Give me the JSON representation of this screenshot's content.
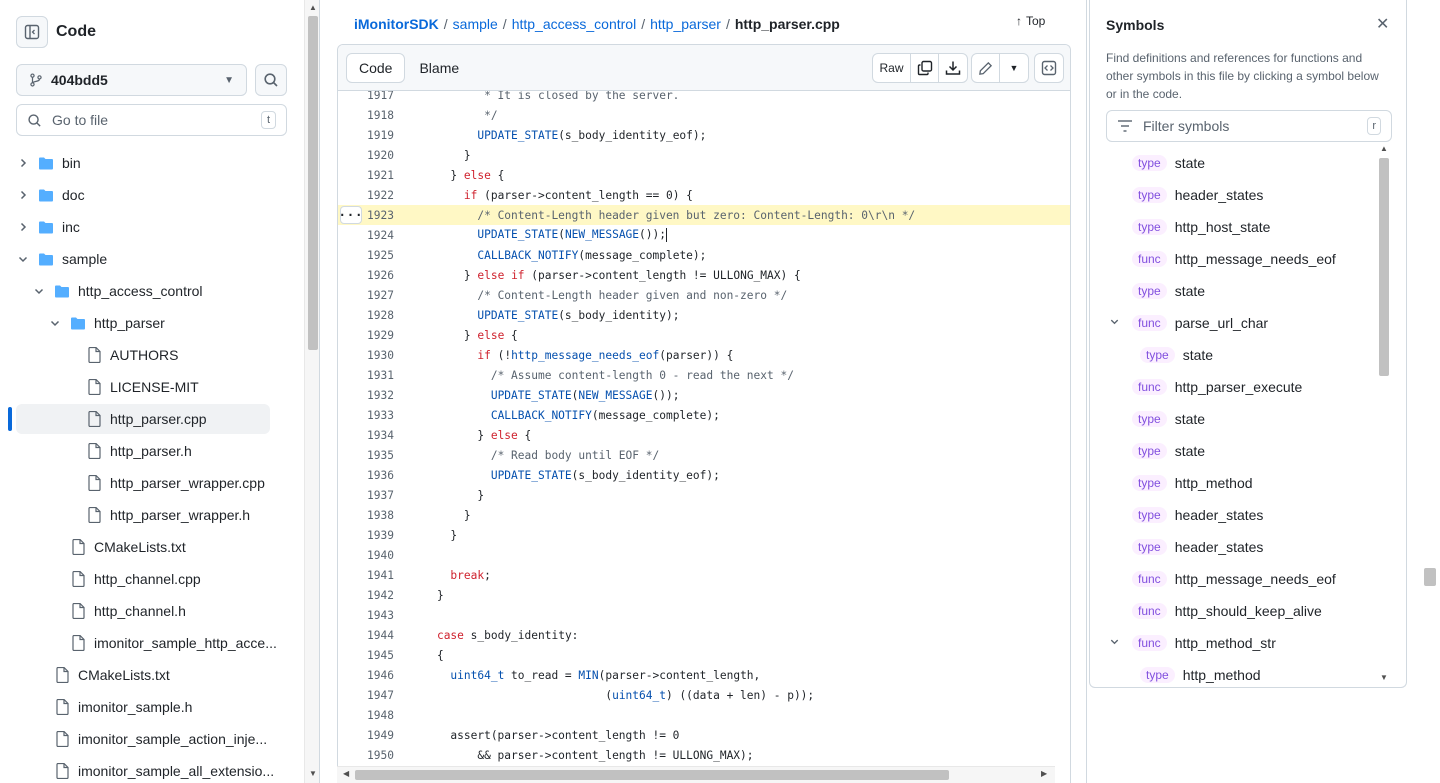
{
  "sidebar": {
    "title": "Code",
    "branch": "404bdd5",
    "goto_placeholder": "Go to file",
    "goto_shortcut": "t",
    "tree": [
      {
        "label": "bin",
        "kind": "folder",
        "depth": 0,
        "expanded": false
      },
      {
        "label": "doc",
        "kind": "folder",
        "depth": 0,
        "expanded": false
      },
      {
        "label": "inc",
        "kind": "folder",
        "depth": 0,
        "expanded": false
      },
      {
        "label": "sample",
        "kind": "folder",
        "depth": 0,
        "expanded": true
      },
      {
        "label": "http_access_control",
        "kind": "folder",
        "depth": 1,
        "expanded": true
      },
      {
        "label": "http_parser",
        "kind": "folder",
        "depth": 2,
        "expanded": true
      },
      {
        "label": "AUTHORS",
        "kind": "file",
        "depth": 3
      },
      {
        "label": "LICENSE-MIT",
        "kind": "file",
        "depth": 3
      },
      {
        "label": "http_parser.cpp",
        "kind": "file",
        "depth": 3,
        "selected": true
      },
      {
        "label": "http_parser.h",
        "kind": "file",
        "depth": 3
      },
      {
        "label": "http_parser_wrapper.cpp",
        "kind": "file",
        "depth": 3
      },
      {
        "label": "http_parser_wrapper.h",
        "kind": "file",
        "depth": 3
      },
      {
        "label": "CMakeLists.txt",
        "kind": "file",
        "depth": 2
      },
      {
        "label": "http_channel.cpp",
        "kind": "file",
        "depth": 2
      },
      {
        "label": "http_channel.h",
        "kind": "file",
        "depth": 2
      },
      {
        "label": "imonitor_sample_http_acce...",
        "kind": "file",
        "depth": 2
      },
      {
        "label": "CMakeLists.txt",
        "kind": "file",
        "depth": 1
      },
      {
        "label": "imonitor_sample.h",
        "kind": "file",
        "depth": 1
      },
      {
        "label": "imonitor_sample_action_inje...",
        "kind": "file",
        "depth": 1
      },
      {
        "label": "imonitor_sample_all_extensio...",
        "kind": "file",
        "depth": 1
      }
    ]
  },
  "breadcrumb": {
    "repo": "iMonitorSDK",
    "parts": [
      "sample",
      "http_access_control",
      "http_parser"
    ],
    "current": "http_parser.cpp",
    "top_label": "Top"
  },
  "toolbar": {
    "code_tab": "Code",
    "blame_tab": "Blame",
    "raw": "Raw"
  },
  "code": {
    "lines": [
      {
        "n": "1917",
        "t": "           * It is closed by the server."
      },
      {
        "n": "1918",
        "t": "           */"
      },
      {
        "n": "1919",
        "t": "          UPDATE_STATE(s_body_identity_eof);"
      },
      {
        "n": "1920",
        "t": "        }"
      },
      {
        "n": "1921",
        "t": "      } else {"
      },
      {
        "n": "1922",
        "t": "        if (parser->content_length == 0) {"
      },
      {
        "n": "1923",
        "t": "          /* Content-Length header given but zero: Content-Length: 0\\r\\n */",
        "hl": true
      },
      {
        "n": "1924",
        "t": "          UPDATE_STATE(NEW_MESSAGE());",
        "cursor": true
      },
      {
        "n": "1925",
        "t": "          CALLBACK_NOTIFY(message_complete);"
      },
      {
        "n": "1926",
        "t": "        } else if (parser->content_length != ULLONG_MAX) {"
      },
      {
        "n": "1927",
        "t": "          /* Content-Length header given and non-zero */"
      },
      {
        "n": "1928",
        "t": "          UPDATE_STATE(s_body_identity);"
      },
      {
        "n": "1929",
        "t": "        } else {"
      },
      {
        "n": "1930",
        "t": "          if (!http_message_needs_eof(parser)) {"
      },
      {
        "n": "1931",
        "t": "            /* Assume content-length 0 - read the next */"
      },
      {
        "n": "1932",
        "t": "            UPDATE_STATE(NEW_MESSAGE());"
      },
      {
        "n": "1933",
        "t": "            CALLBACK_NOTIFY(message_complete);"
      },
      {
        "n": "1934",
        "t": "          } else {"
      },
      {
        "n": "1935",
        "t": "            /* Read body until EOF */"
      },
      {
        "n": "1936",
        "t": "            UPDATE_STATE(s_body_identity_eof);"
      },
      {
        "n": "1937",
        "t": "          }"
      },
      {
        "n": "1938",
        "t": "        }"
      },
      {
        "n": "1939",
        "t": "      }"
      },
      {
        "n": "1940",
        "t": ""
      },
      {
        "n": "1941",
        "t": "      break;"
      },
      {
        "n": "1942",
        "t": "    }"
      },
      {
        "n": "1943",
        "t": ""
      },
      {
        "n": "1944",
        "t": "    case s_body_identity:"
      },
      {
        "n": "1945",
        "t": "    {"
      },
      {
        "n": "1946",
        "t": "      uint64_t to_read = MIN(parser->content_length,"
      },
      {
        "n": "1947",
        "t": "                             (uint64_t) ((data + len) - p));"
      },
      {
        "n": "1948",
        "t": ""
      },
      {
        "n": "1949",
        "t": "      assert(parser->content_length != 0"
      },
      {
        "n": "1950",
        "t": "          && parser->content_length != ULLONG_MAX);"
      }
    ]
  },
  "symbols": {
    "title": "Symbols",
    "description": "Find definitions and references for functions and other symbols in this file by clicking a symbol below or in the code.",
    "filter_placeholder": "Filter symbols",
    "filter_shortcut": "r",
    "items": [
      {
        "kind": "type",
        "name": "state",
        "depth": 0
      },
      {
        "kind": "type",
        "name": "header_states",
        "depth": 0
      },
      {
        "kind": "type",
        "name": "http_host_state",
        "depth": 0
      },
      {
        "kind": "func",
        "name": "http_message_needs_eof",
        "depth": 0
      },
      {
        "kind": "type",
        "name": "state",
        "depth": 0
      },
      {
        "kind": "func",
        "name": "parse_url_char",
        "depth": 0,
        "expanded": true
      },
      {
        "kind": "type",
        "name": "state",
        "depth": 1
      },
      {
        "kind": "func",
        "name": "http_parser_execute",
        "depth": 0
      },
      {
        "kind": "type",
        "name": "state",
        "depth": 0
      },
      {
        "kind": "type",
        "name": "state",
        "depth": 0
      },
      {
        "kind": "type",
        "name": "http_method",
        "depth": 0
      },
      {
        "kind": "type",
        "name": "header_states",
        "depth": 0
      },
      {
        "kind": "type",
        "name": "header_states",
        "depth": 0
      },
      {
        "kind": "func",
        "name": "http_message_needs_eof",
        "depth": 0
      },
      {
        "kind": "func",
        "name": "http_should_keep_alive",
        "depth": 0
      },
      {
        "kind": "func",
        "name": "http_method_str",
        "depth": 0,
        "expanded": true
      },
      {
        "kind": "type",
        "name": "http_method",
        "depth": 1
      }
    ]
  },
  "colors": {
    "accent": "#0969da",
    "keyword": "#cf222e",
    "function": "#0550ae",
    "comment": "#59636e",
    "highlight": "#fff8c5",
    "badge": "#8250df"
  }
}
